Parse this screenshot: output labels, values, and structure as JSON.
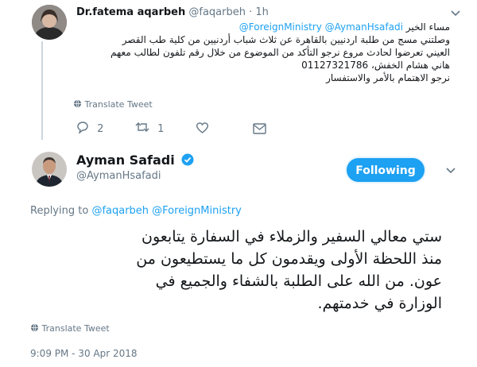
{
  "top_tweet": {
    "display_name": "Dr.fatema aqarbeh",
    "handle": "@faqarbeh",
    "separator": "·",
    "time": "1h",
    "line1_mentions": "@ForeignMinistry @AymanHsafadi",
    "line1_greeting": "مساء الخير",
    "body_lines": [
      "وصلتني مسج من طلبة اردنيين بالقاهرة عن ثلاث شباب أردنيين من كلية طب القصر",
      "العيني تعرضوا لحادث مروع نرجو التأكد من الموضوع من خلال رقم تلفون لطالب معهم",
      "هاني هشام الخفش، 01127321786",
      "نرجو الاهتمام بالأمر والاستفسار"
    ],
    "translate": "Translate Tweet",
    "actions": {
      "replies": "2",
      "retweets": "1"
    }
  },
  "main_tweet": {
    "display_name": "Ayman Safadi",
    "handle": "@AymanHsafadi",
    "follow_label": "Following",
    "replying_prefix": "Replying to",
    "replying_to": "@faqarbeh @ForeignMinistry",
    "body_lines": [
      "ستي معالي السفير والزملاء في السفارة يتابعون",
      "منذ اللحظة الأولى ويقدمون كل ما يستطيعون من",
      "عون. من الله على الطلبة بالشفاء والجميع في",
      "الوزارة في خدمتهم."
    ],
    "translate": "Translate Tweet",
    "timestamp": "9:09 PM - 30 Apr 2018"
  },
  "colors": {
    "accent": "#1da1f2",
    "muted": "#657786",
    "verified": "#1da1f2"
  }
}
